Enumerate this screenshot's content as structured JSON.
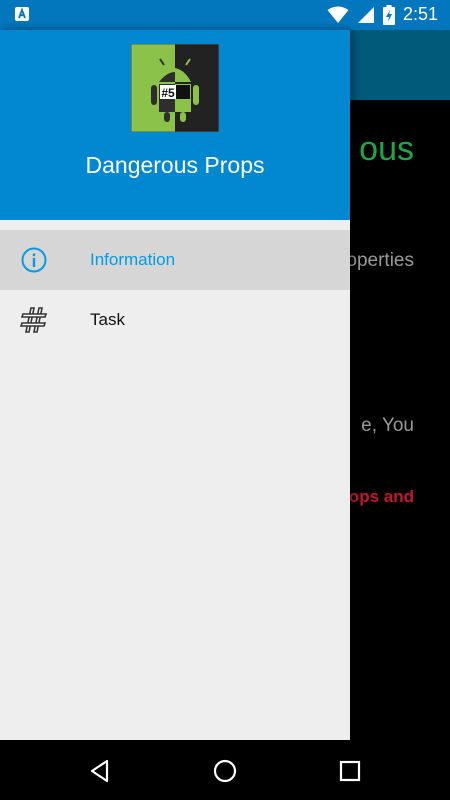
{
  "status_bar": {
    "time": "2:51",
    "notification_icon": "a-badge-icon",
    "wifi_icon": "wifi-icon",
    "signal_icon": "cell-signal-icon",
    "battery_icon": "battery-charging-icon"
  },
  "background": {
    "title_fragment": "ous",
    "line1": "operties",
    "line2": "e, You",
    "line3": "ops and"
  },
  "drawer": {
    "app_name": "Dangerous Props",
    "logo_badge": "#5",
    "items": [
      {
        "label": "Information",
        "icon": "info-icon",
        "active": true
      },
      {
        "label": "Task",
        "icon": "hash-icon",
        "active": false
      }
    ]
  },
  "nav_bar": {
    "back_icon": "back-triangle-icon",
    "home_icon": "home-circle-icon",
    "recents_icon": "recents-square-icon"
  },
  "colors": {
    "drawer_header": "#0288d1",
    "status_bar": "#0277bd",
    "active_item_text": "#039be5",
    "active_item_bg": "#d6d6d6",
    "drawer_bg": "#eeeeee"
  }
}
